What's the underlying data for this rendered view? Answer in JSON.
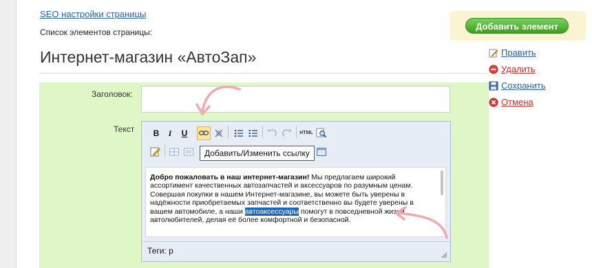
{
  "header": {
    "seo_link": "SEO настройки страницы",
    "list_title": "Список элементов страницы:",
    "page_title": "Интернет-магазин «АвтоЗап»"
  },
  "add_panel": {
    "button_label": "Добавить элемент"
  },
  "actions": {
    "edit": "Править",
    "delete": "Удалить",
    "save": "Сохранить",
    "cancel": "Отмена"
  },
  "form": {
    "title_label": "Заголовок:",
    "title_value": "",
    "text_label": "Текст"
  },
  "editor": {
    "toolbar_row1": [
      {
        "name": "bold",
        "glyph": "B"
      },
      {
        "name": "italic",
        "glyph": "I"
      },
      {
        "name": "underline",
        "glyph": "U"
      },
      {
        "name": "link",
        "glyph": "🔗"
      },
      {
        "name": "unlink",
        "glyph": "✂"
      },
      {
        "name": "bullet-list",
        "glyph": "☰"
      },
      {
        "name": "numbered-list",
        "glyph": "☷"
      },
      {
        "name": "undo",
        "glyph": "↶"
      },
      {
        "name": "redo",
        "glyph": "↷"
      },
      {
        "name": "html",
        "glyph": "HTML"
      },
      {
        "name": "find",
        "glyph": "🔍"
      }
    ],
    "tooltip": "Добавить/Изменить ссылку",
    "content": {
      "bold_intro": "Добро пожаловать в наш интернет-магазин!",
      "text_part1": " Мы предлагаем широкий ассортимент качественных автозапчастей и аксессуаров по разумным ценам. Совершая покупки в нашем Интернет-магазине, вы можете быть уверены в надёжности приобретаемых запчастей и соответственно вы будете уверены в вашем автомобиле, а наши ",
      "selected": "автоаксессуары",
      "text_part2": " помогут в повседневной жизни автолюбителей, делая её более комфортной и безопасной."
    },
    "tags": "Теги: p"
  },
  "colors": {
    "form_bg": "#dff7c7",
    "add_button": "#3d9f1f",
    "link_blue": "#2a61a8",
    "delete_red": "#c0322a",
    "selection": "#1d65b8",
    "arrow_pink": "#f1a9ad"
  }
}
